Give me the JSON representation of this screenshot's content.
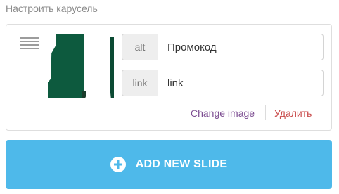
{
  "section": {
    "title": "Настроить карусель"
  },
  "slide": {
    "alt": {
      "addon": "alt",
      "value": "Промокод"
    },
    "link": {
      "addon": "link",
      "value": "link"
    },
    "change_label": "Change image",
    "delete_label": "Удалить",
    "thumbnail_icon": "slide-thumbnail"
  },
  "add_button": {
    "label": "ADD NEW SLIDE",
    "icon": "plus-circle-icon"
  },
  "colors": {
    "accent": "#4eb9ea",
    "change_link": "#7d4e92",
    "delete_link": "#c94b4b",
    "thumbnail_green": "#0d5a3e"
  }
}
